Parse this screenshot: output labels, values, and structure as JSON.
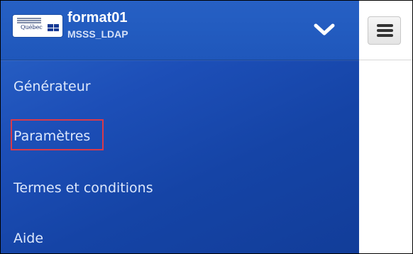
{
  "header": {
    "logo": {
      "text": "Québec",
      "icon": "quebec-government-logo-icon"
    },
    "username": "format01",
    "domain": "MSSS_LDAP",
    "expand_icon": "chevron-down-icon"
  },
  "menu": {
    "items": [
      {
        "label": "Générateur"
      },
      {
        "label": "Paramètres",
        "highlighted": true
      },
      {
        "label": "Termes et conditions"
      },
      {
        "label": "Aide"
      }
    ]
  },
  "toolbar": {
    "menu_icon": "hamburger-menu-icon"
  },
  "colors": {
    "drawer_background": "#1d4fb8",
    "header_background": "#2260c2",
    "menu_text": "#dce7fb",
    "highlight": "#d93a4a",
    "page_background": "#ffffff"
  }
}
